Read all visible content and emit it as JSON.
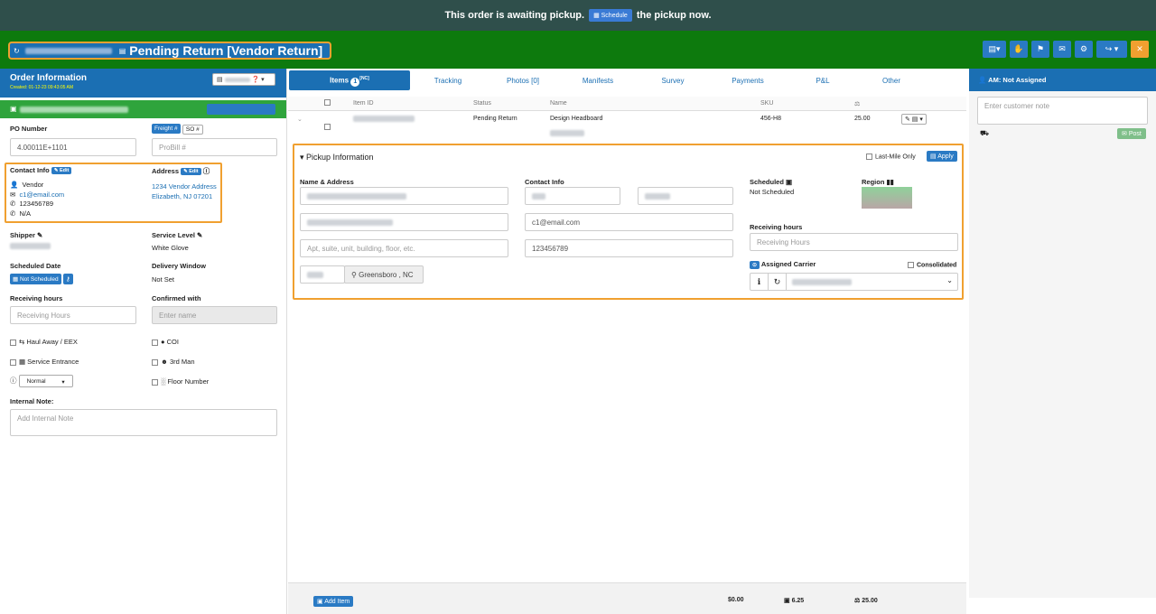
{
  "banner": {
    "text_before": "This order is awaiting pickup.",
    "button": "Schedule",
    "text_after": "the pickup now."
  },
  "header": {
    "title": "Pending Return [Vendor Return]"
  },
  "order": {
    "title": "Order Information",
    "created": "Created: 01-12-23 09:43:05 AM",
    "po_label": "PO Number",
    "po_value": "4.00011E+1101",
    "freight_btn": "Freight #",
    "so_btn": "SO #",
    "probill_ph": "ProBill #",
    "contact_label": "Contact Info",
    "edit": "Edit",
    "contact_type": "Vendor",
    "contact_email": "c1@email.com",
    "contact_phone": "123456789",
    "contact_alt": "N/A",
    "address_label": "Address",
    "address_line1": "1234 Vendor Address",
    "address_line2": "Elizabeth, NJ 07201",
    "shipper_label": "Shipper",
    "service_label": "Service Level",
    "service_value": "White Glove",
    "sched_label": "Scheduled Date",
    "sched_btn": "Not Scheduled",
    "delivery_label": "Delivery Window",
    "delivery_value": "Not Set",
    "recv_label": "Receiving hours",
    "recv_ph": "Receiving Hours",
    "confirmed_label": "Confirmed with",
    "confirmed_ph": "Enter name",
    "haul": "Haul Away / EEX",
    "coi": "COI",
    "service_entrance": "Service Entrance",
    "third_man": "3rd Man",
    "priority": "Normal",
    "floor": "Floor Number",
    "note_label": "Internal Note:",
    "note_ph": "Add Internal Note"
  },
  "tabs": [
    "Items",
    "Tracking",
    "Photos [0]",
    "Manifests",
    "Survey",
    "Payments",
    "P&L",
    "Other"
  ],
  "items_badge": "1",
  "items_sup": "[NC]",
  "table": {
    "headers": [
      "Item ID",
      "Status",
      "Name",
      "SKU"
    ],
    "row": {
      "status": "Pending Return",
      "name": "Design Headboard",
      "sku": "456-H8",
      "weight": "25.00"
    }
  },
  "pickup": {
    "title": "Pickup Information",
    "last_mile": "Last-Mile Only",
    "apply": "Apply",
    "name_label": "Name & Address",
    "contact_label": "Contact Info",
    "suite_ph": "Apt, suite, unit, building, floor, etc.",
    "email": "c1@email.com",
    "phone": "123456789",
    "city": "Greensboro , NC",
    "scheduled_label": "Scheduled",
    "scheduled_value": "Not Scheduled",
    "region_label": "Region",
    "recv_label": "Receiving hours",
    "recv_ph": "Receiving Hours",
    "carrier_label": "Assigned Carrier",
    "consolidated": "Consolidated"
  },
  "footer": {
    "add_item": "Add Item",
    "total": "$0.00",
    "cube": "6.25",
    "weight": "25.00"
  },
  "am": {
    "label": "AM: Not Assigned",
    "note_ph": "Enter customer note",
    "post": "Post"
  }
}
